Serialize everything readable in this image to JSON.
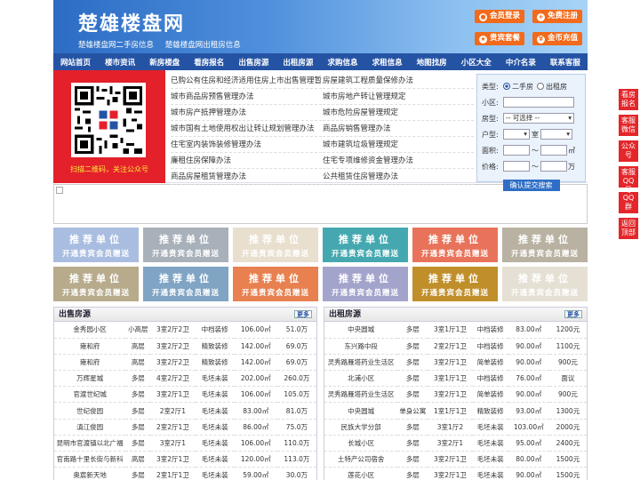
{
  "header": {
    "title": "楚雄楼盘网",
    "sub1": "楚雄楼盘网二手房信息",
    "sub2": "楚雄楼盘网出租房信息",
    "buttons": [
      "会员登录",
      "免费注册",
      "贵宾套餐",
      "金币充值"
    ]
  },
  "nav": [
    "网站首页",
    "楼市资讯",
    "新房楼盘",
    "看房报名",
    "出售房源",
    "出租房源",
    "求购信息",
    "求租信息",
    "地图找房",
    "小区大全",
    "中介名录",
    "联系客服"
  ],
  "qr": {
    "caption": "扫描二维码，关注公众号"
  },
  "links_left": [
    "已购公有住房和经济适用住房上市出售管理暂",
    "城市商品房预售管理办法",
    "城市房产抵押管理办法",
    "城市国有土地使用权出让转让规划管理办法",
    "住宅室内装饰装修管理办法",
    "廉租住房保障办法",
    "商品房屋租赁管理办法"
  ],
  "links_right": [
    "房屋建筑工程质量保修办法",
    "城市房地产转让管理规定",
    "城市危险房屋管理规定",
    "商品房销售管理办法",
    "城市建筑垃圾管理规定",
    "住宅专项维修资金管理办法",
    "公共租赁住房管理办法"
  ],
  "search": {
    "type_label": "类型:",
    "opt1": "二手房",
    "opt2": "出租房",
    "community_label": "小区:",
    "housetype_label": "房型:",
    "housetype_value": "-- 可选择 --",
    "layout_label": "户型:",
    "room_unit": "室",
    "area_label": "面积:",
    "area_sep": "～",
    "area_unit": "㎡",
    "price_label": "价格:",
    "price_sep": "～",
    "price_unit": "万",
    "submit": "确认提交搜索"
  },
  "ads": {
    "line1": "推荐单位",
    "line2": "开通贵宾会员赠送",
    "colors": [
      "#a9bde0",
      "#a8b0ba",
      "#e8dfcf",
      "#45a8b0",
      "#e8735a",
      "#b9b2a2",
      "#b7ab8c",
      "#7fa4c4",
      "#e8804f",
      "#a3a4cc",
      "#c08f2a",
      "#e6e0d4"
    ]
  },
  "sale": {
    "title": "出售房源",
    "more": "更多",
    "rows": [
      [
        "金秀园小区",
        "小高层",
        "3室2厅2卫",
        "中档装修",
        "106.00㎡",
        "51.0万"
      ],
      [
        "雍和府",
        "高层",
        "3室2厅2卫",
        "精致装修",
        "142.00㎡",
        "69.0万"
      ],
      [
        "雍和府",
        "高层",
        "3室2厅2卫",
        "精致装修",
        "142.00㎡",
        "69.0万"
      ],
      [
        "万辉星城",
        "多层",
        "4室2厅2卫",
        "毛坯未装",
        "202.00㎡",
        "260.0万"
      ],
      [
        "官渡世纪城",
        "多层",
        "3室2厅1卫",
        "毛坯未装",
        "106.00㎡",
        "105.0万"
      ],
      [
        "世纪俊园",
        "多层",
        "2室2厅1",
        "毛坯未装",
        "83.00㎡",
        "81.0万"
      ],
      [
        "滇江俊园",
        "多层",
        "2室2厅1卫",
        "毛坯未装",
        "86.00㎡",
        "75.0万"
      ],
      [
        "昆明市官渡镇以北广福",
        "多层",
        "3室2厅1",
        "毛坯未装",
        "106.00㎡",
        "110.0万"
      ],
      [
        "官南路十里长街与新科",
        "高层",
        "3室2厅1卫",
        "毛坯未装",
        "120.00㎡",
        "113.0万"
      ],
      [
        "奥宸新天地",
        "多层",
        "2室1厅1卫",
        "毛坯未装",
        "59.00㎡",
        "30.0万"
      ]
    ]
  },
  "rent": {
    "title": "出租房源",
    "more": "更多",
    "rows": [
      [
        "中央圆城",
        "多层",
        "3室1厅1卫",
        "中档装修",
        "83.00㎡",
        "1200元"
      ],
      [
        "东兴路中段",
        "多层",
        "2室2厅1卫",
        "中档装修",
        "90.00㎡",
        "1100元"
      ],
      [
        "灵秀路雁塔药业生活区",
        "多层",
        "3室2厅1卫",
        "简单装修",
        "90.00㎡",
        "900元"
      ],
      [
        "北浦小区",
        "多层",
        "3室1厅1卫",
        "中档装修",
        "76.00㎡",
        "面议"
      ],
      [
        "灵秀路雁塔药业生活区",
        "多层",
        "3室2厅1卫",
        "简单装修",
        "90.00㎡",
        "900元"
      ],
      [
        "中央圆城",
        "单身公寓",
        "1室1厅1卫",
        "精致装修",
        "93.00㎡",
        "1300元"
      ],
      [
        "民族大学分部",
        "多层",
        "3室1厅2",
        "毛坯未装",
        "103.00㎡",
        "2000元"
      ],
      [
        "长城小区",
        "多层",
        "3室2厅1",
        "毛坯未装",
        "95.00㎡",
        "2400元"
      ],
      [
        "土特产公司宿舍",
        "多层",
        "3室2厅1卫",
        "毛坯未装",
        "80.00㎡",
        "1500元"
      ],
      [
        "莲花小区",
        "多层",
        "3室2厅1卫",
        "毛坯未装",
        "90.00㎡",
        "1500元"
      ]
    ]
  },
  "sidebar": [
    "看房报名",
    "客服微信",
    "公众号",
    "客服QQ号",
    "QQ群",
    "返回顶部"
  ]
}
